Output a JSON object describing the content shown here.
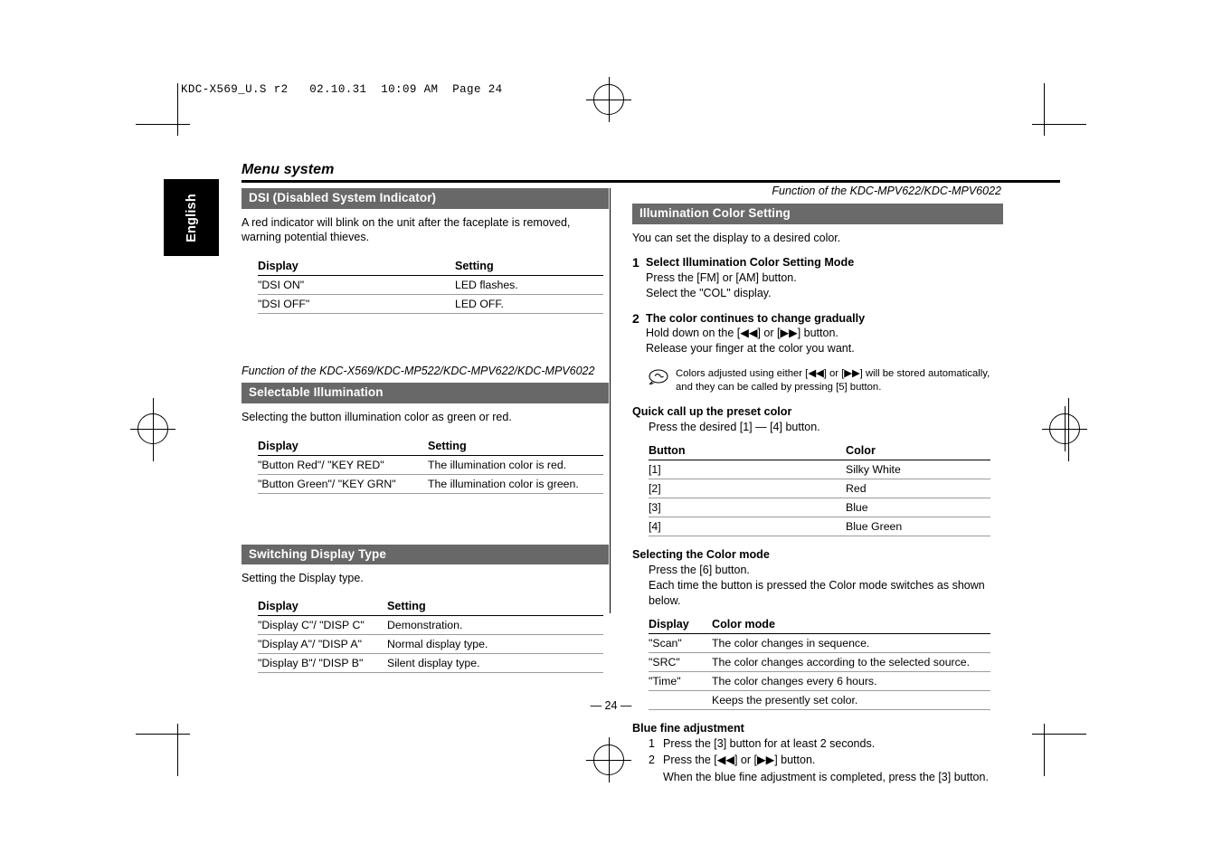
{
  "filestamp": "KDC-X569_U.S r2   02.10.31  10:09 AM  Page 24",
  "language_tab": "English",
  "running_head": "Menu system",
  "page_number": "— 24 —",
  "left_column": {
    "dsi": {
      "title": "DSI (Disabled System Indicator)",
      "body": "A red indicator will blink on the unit after the faceplate is removed, warning potential thieves.",
      "table": {
        "headers": [
          "Display",
          "Setting"
        ],
        "rows": [
          [
            "\"DSI ON\"",
            "LED flashes."
          ],
          [
            "\"DSI OFF\"",
            "LED OFF."
          ]
        ]
      }
    },
    "function_note": "Function of the KDC-X569/KDC-MP522/KDC-MPV622/KDC-MPV6022",
    "selectable_illumination": {
      "title": "Selectable Illumination",
      "body": "Selecting the button illumination color as green or red.",
      "table": {
        "headers": [
          "Display",
          "Setting"
        ],
        "rows": [
          [
            "\"Button Red\"/ \"KEY RED\"",
            "The illumination color is red."
          ],
          [
            "\"Button Green\"/ \"KEY GRN\"",
            "The illumination color is green."
          ]
        ]
      }
    },
    "switching_display_type": {
      "title": "Switching Display Type",
      "body": "Setting the Display type.",
      "table": {
        "headers": [
          "Display",
          "Setting"
        ],
        "rows": [
          [
            "\"Display C\"/ \"DISP C\"",
            "Demonstration."
          ],
          [
            "\"Display A\"/ \"DISP A\"",
            "Normal display type."
          ],
          [
            "\"Display B\"/ \"DISP B\"",
            "Silent display type."
          ]
        ]
      }
    }
  },
  "right_column": {
    "function_note": "Function of the KDC-MPV622/KDC-MPV6022",
    "illumination_color_setting": {
      "title": "Illumination Color Setting",
      "body": "You can set the display to a desired color.",
      "steps": [
        {
          "num": "1",
          "title": "Select Illumination Color Setting Mode",
          "lines": [
            "Press the [FM] or [AM] button.",
            "Select the \"COL\" display."
          ]
        },
        {
          "num": "2",
          "title": "The color continues to change gradually",
          "lines": [
            "Hold down on the [◀◀] or [▶▶] button.",
            "Release your finger at the color you want."
          ]
        }
      ],
      "note": "Colors adjusted using either [◀◀] or [▶▶] will be stored automatically, and they can be called by pressing [5] button.",
      "quick_call": {
        "heading": "Quick call up the preset color",
        "instruction": "Press the desired [1] — [4] button.",
        "table": {
          "headers": [
            "Button",
            "Color"
          ],
          "rows": [
            [
              "[1]",
              "Silky White"
            ],
            [
              "[2]",
              "Red"
            ],
            [
              "[3]",
              "Blue"
            ],
            [
              "[4]",
              "Blue Green"
            ]
          ]
        }
      },
      "color_mode": {
        "heading": "Selecting the Color mode",
        "lines": [
          "Press the [6] button.",
          "Each time the button is pressed the Color mode switches as shown below."
        ],
        "table": {
          "headers": [
            "Display",
            "Color mode"
          ],
          "rows": [
            [
              "\"Scan\"",
              "The color changes in sequence."
            ],
            [
              "\"SRC\"",
              "The color changes according to the selected source."
            ],
            [
              "\"Time\"",
              "The color changes every 6 hours."
            ],
            [
              "",
              "Keeps the presently set color."
            ]
          ]
        }
      },
      "blue_fine": {
        "heading": "Blue fine adjustment",
        "items": [
          {
            "num": "1",
            "text": "Press the [3] button for at least 2 seconds."
          },
          {
            "num": "2",
            "text": "Press the [◀◀] or [▶▶] button."
          }
        ],
        "trailing": "When the blue fine adjustment is completed, press the [3] button."
      }
    }
  }
}
